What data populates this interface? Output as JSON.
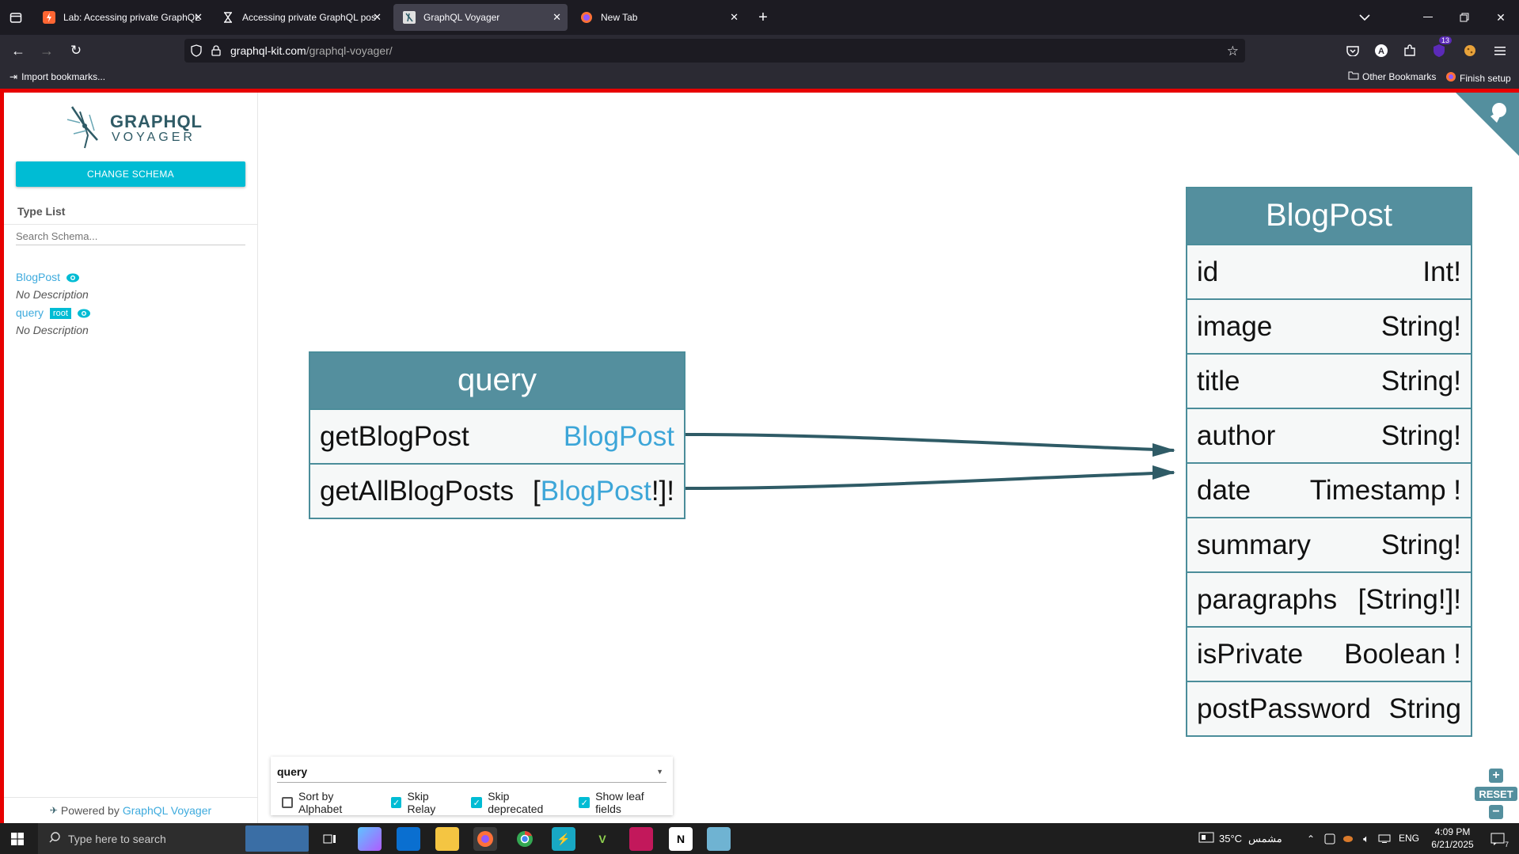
{
  "browser": {
    "tabs": [
      {
        "title": "Lab: Accessing private GraphQL",
        "active": false
      },
      {
        "title": "Accessing private GraphQL pos",
        "active": false
      },
      {
        "title": "GraphQL Voyager",
        "active": true
      },
      {
        "title": "New Tab",
        "active": false
      }
    ],
    "url_domain": "graphql-kit.com",
    "url_path": "/graphql-voyager/",
    "bookmarks": {
      "import": "Import bookmarks...",
      "other": "Other Bookmarks",
      "finish": "Finish setup"
    },
    "extensions_badge": "13"
  },
  "sidebar": {
    "logo_line1": "GRAPHQL",
    "logo_line2": "VOYAGER",
    "change_schema": "CHANGE SCHEMA",
    "type_list_title": "Type List",
    "search_placeholder": "Search Schema...",
    "types": [
      {
        "name": "BlogPost",
        "desc": "No Description",
        "root": ""
      },
      {
        "name": "query",
        "desc": "No Description",
        "root": "root"
      }
    ],
    "powered_by": "Powered by",
    "powered_link": "GraphQL Voyager"
  },
  "graph": {
    "query": {
      "title": "query",
      "fields": [
        {
          "name": "getBlogPost",
          "pre": "",
          "type": "BlogPost",
          "post": ""
        },
        {
          "name": "getAllBlogPosts",
          "pre": "[",
          "type": "BlogPost",
          "post": "!]!"
        }
      ]
    },
    "blogpost": {
      "title": "BlogPost",
      "fields": [
        {
          "name": "id",
          "type": "Int!"
        },
        {
          "name": "image",
          "type": "String!"
        },
        {
          "name": "title",
          "type": "String!"
        },
        {
          "name": "author",
          "type": "String!"
        },
        {
          "name": "date",
          "type": "Timestamp !"
        },
        {
          "name": "summary",
          "type": "String!"
        },
        {
          "name": "paragraphs",
          "type": "[String!]!"
        },
        {
          "name": "isPrivate",
          "type": "Boolean !"
        },
        {
          "name": "postPassword",
          "type": "String"
        }
      ]
    }
  },
  "panel": {
    "root": "query",
    "options": [
      {
        "label": "Sort by Alphabet",
        "checked": false
      },
      {
        "label": "Skip Relay",
        "checked": true
      },
      {
        "label": "Skip deprecated",
        "checked": true
      },
      {
        "label": "Show leaf fields",
        "checked": true
      }
    ],
    "reset": "RESET"
  },
  "taskbar": {
    "search_placeholder": "Type here to search",
    "weather": "35°C",
    "weather_desc": "مشمس",
    "lang": "ENG",
    "time": "4:09 PM",
    "date": "6/21/2025",
    "notif_count": "7"
  }
}
